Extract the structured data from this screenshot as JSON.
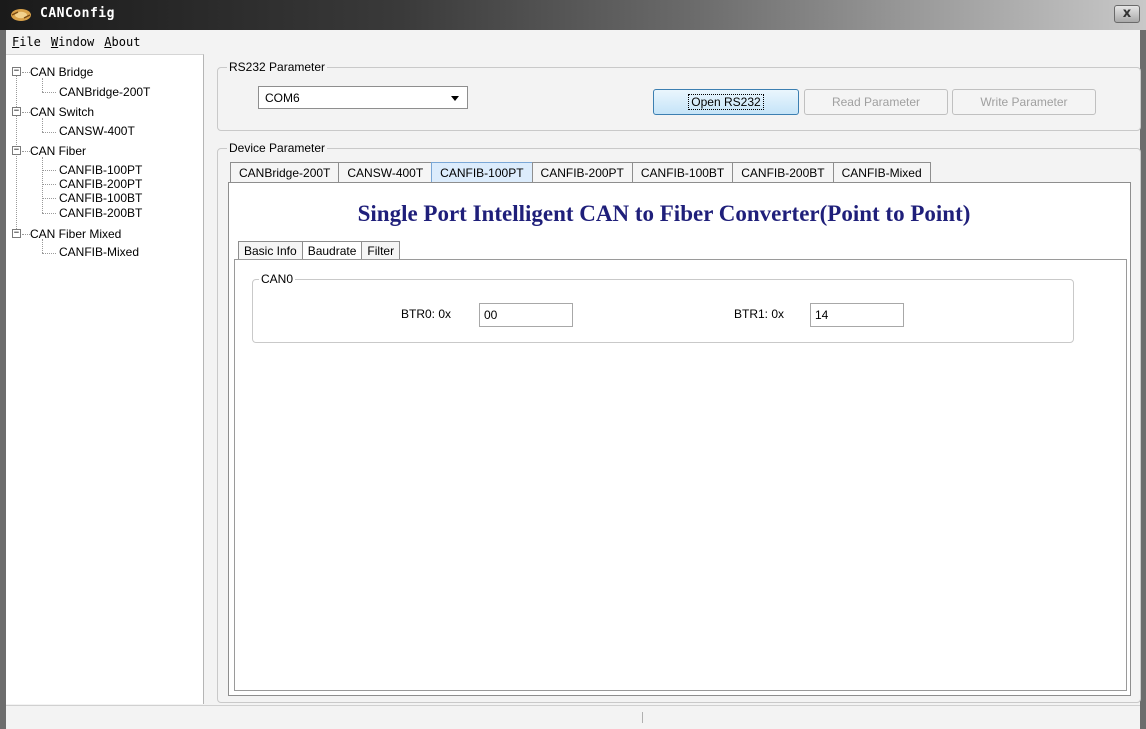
{
  "window": {
    "title": "CANConfig",
    "close_glyph": "x"
  },
  "menu": [
    {
      "first": "F",
      "rest": "ile"
    },
    {
      "first": "W",
      "rest": "indow"
    },
    {
      "first": "A",
      "rest": "bout"
    }
  ],
  "tree": {
    "toggle_glyph": "−",
    "groups": [
      {
        "label": "CAN Bridge",
        "children": [
          "CANBridge-200T"
        ]
      },
      {
        "label": "CAN Switch",
        "children": [
          "CANSW-400T"
        ]
      },
      {
        "label": "CAN Fiber",
        "children": [
          "CANFIB-100PT",
          "CANFIB-200PT",
          "CANFIB-100BT",
          "CANFIB-200BT"
        ]
      },
      {
        "label": "CAN Fiber Mixed",
        "children": [
          "CANFIB-Mixed"
        ]
      }
    ]
  },
  "rs232": {
    "group_title": "RS232 Parameter",
    "port_value": "COM6",
    "open_label": "Open RS232",
    "read_label": "Read Parameter",
    "write_label": "Write Parameter"
  },
  "device": {
    "group_title": "Device Parameter",
    "tabs": [
      "CANBridge-200T",
      "CANSW-400T",
      "CANFIB-100PT",
      "CANFIB-200PT",
      "CANFIB-100BT",
      "CANFIB-200BT",
      "CANFIB-Mixed"
    ],
    "active_tab": "CANFIB-100PT",
    "banner": "Single Port Intelligent CAN to Fiber Converter(Point to Point)",
    "subtabs": [
      "Basic Info",
      "Baudrate",
      "Filter"
    ],
    "active_subtab": "Baudrate",
    "can0": {
      "group_title": "CAN0",
      "btr0_label": "BTR0: 0x",
      "btr0_value": "00",
      "btr1_label": "BTR1: 0x",
      "btr1_value": "14"
    }
  },
  "colors": {
    "title_gradient_start": "#1a1a1a",
    "banner_text": "#1f1f7a",
    "active_tab": "#dcecfc"
  }
}
